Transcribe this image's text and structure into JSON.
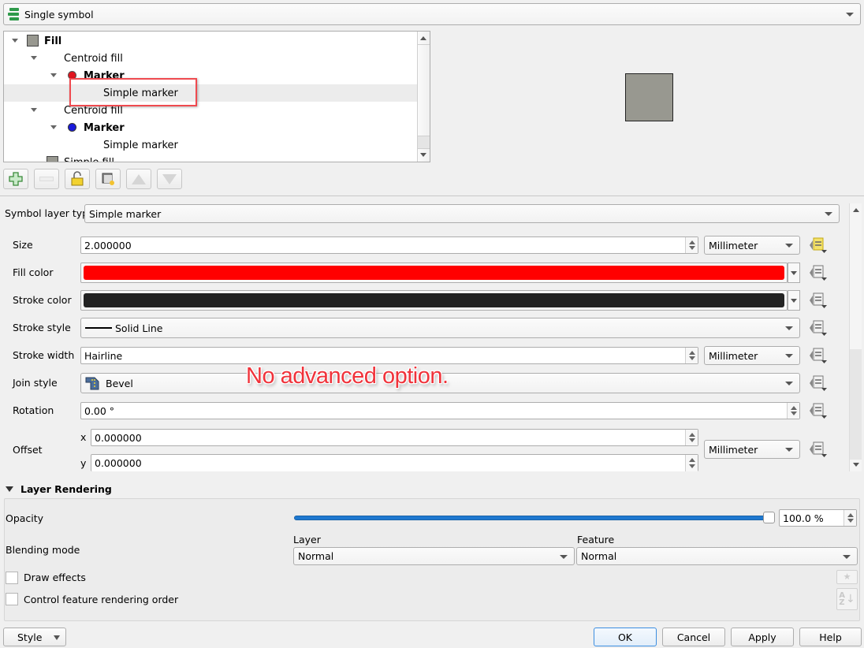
{
  "renderer": {
    "selected": "Single symbol",
    "icon": "single-symbol-icon"
  },
  "tree": {
    "items": [
      {
        "label": "Fill",
        "bold": true,
        "icon": "fill-swatch",
        "level": 0
      },
      {
        "label": "Centroid fill",
        "bold": false,
        "level": 1
      },
      {
        "label": "Marker",
        "bold": true,
        "icon": "red-dot",
        "level": 2
      },
      {
        "label": "Simple marker",
        "bold": false,
        "level": 3,
        "selected": true
      },
      {
        "label": "Centroid fill",
        "bold": false,
        "level": 1
      },
      {
        "label": "Marker",
        "bold": true,
        "icon": "blue-dot",
        "level": 2
      },
      {
        "label": "Simple marker",
        "bold": false,
        "level": 3
      },
      {
        "label": "Simple fill",
        "bold": false,
        "icon": "fill-swatch",
        "level": 1
      }
    ]
  },
  "toolbar": {
    "add": "add-layer",
    "remove": "remove-layer",
    "lock": "lock-layer-color",
    "duplicate": "duplicate-layer",
    "up": "move-up",
    "down": "move-down"
  },
  "layer_type": {
    "label": "Symbol layer type",
    "value": "Simple marker"
  },
  "properties": {
    "size": {
      "label": "Size",
      "value": "2.000000",
      "unit": "Millimeter"
    },
    "fill_color": {
      "label": "Fill color",
      "color": "#ff0000"
    },
    "stroke_color": {
      "label": "Stroke color",
      "color": "#232323"
    },
    "stroke_style": {
      "label": "Stroke style",
      "value": "Solid Line"
    },
    "stroke_width": {
      "label": "Stroke width",
      "value": "Hairline",
      "unit": "Millimeter"
    },
    "join_style": {
      "label": "Join style",
      "value": "Bevel"
    },
    "rotation": {
      "label": "Rotation",
      "value": "0.00 °"
    },
    "offset": {
      "label": "Offset",
      "x_label": "x",
      "x": "0.000000",
      "y_label": "y",
      "y": "0.000000",
      "unit": "Millimeter"
    }
  },
  "annotation": {
    "text": "No advanced option.",
    "color": "#f0323a"
  },
  "rendering": {
    "title": "Layer Rendering",
    "opacity_label": "Opacity",
    "opacity_value": "100.0 %",
    "opacity_fraction": 1.0,
    "blending_label": "Blending mode",
    "layer_label": "Layer",
    "layer_value": "Normal",
    "feature_label": "Feature",
    "feature_value": "Normal",
    "draw_effects": "Draw effects",
    "control_order": "Control feature rendering order"
  },
  "footer": {
    "style": "Style",
    "ok": "OK",
    "cancel": "Cancel",
    "apply": "Apply",
    "help": "Help"
  },
  "preview": {
    "fill": "#989890",
    "stroke": "#232323"
  }
}
